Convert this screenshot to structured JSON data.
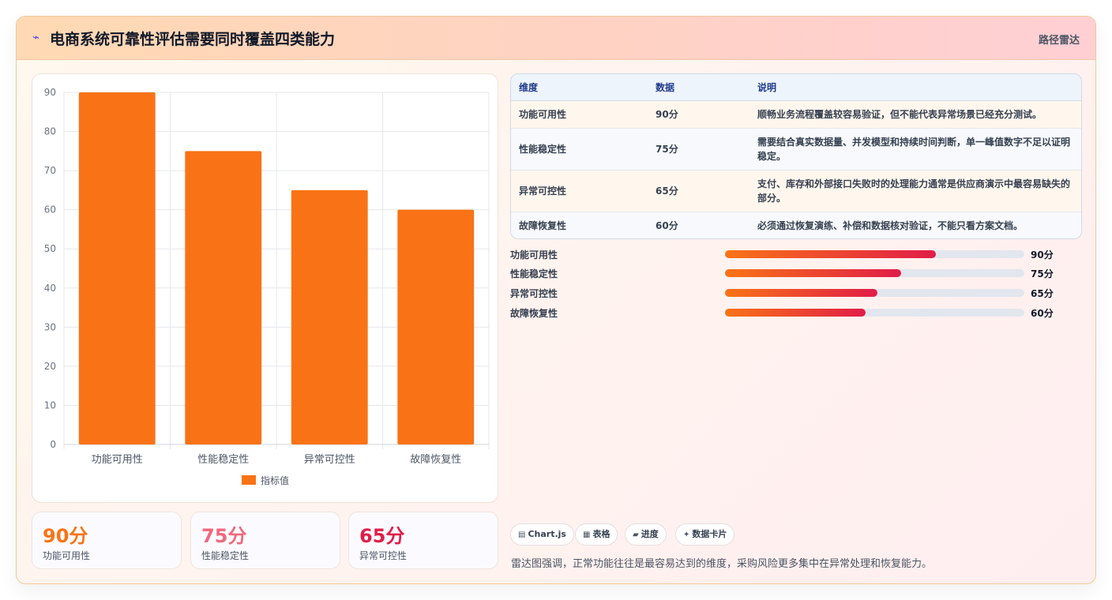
{
  "header": {
    "title": "电商系统可靠性评估需要同时覆盖四类能力",
    "tag": "路径雷达"
  },
  "chart_data": {
    "type": "bar",
    "categories": [
      "功能可用性",
      "性能稳定性",
      "异常可控性",
      "故障恢复性"
    ],
    "series": [
      {
        "name": "指标值",
        "values": [
          90,
          75,
          65,
          60
        ]
      }
    ],
    "ylim": [
      0,
      90
    ],
    "yticks": [
      0,
      10,
      20,
      30,
      40,
      50,
      60,
      70,
      80,
      90
    ],
    "bar_color": "#f97316",
    "grid": true,
    "legend": "bottom"
  },
  "stats": [
    {
      "value": "90分",
      "label": "功能可用性",
      "color": "#f97316"
    },
    {
      "value": "75分",
      "label": "性能稳定性",
      "color": "#f0687c"
    },
    {
      "value": "65分",
      "label": "异常可控性",
      "color": "#e11d48"
    }
  ],
  "table": {
    "headers": [
      "维度",
      "数据",
      "说明"
    ],
    "rows": [
      [
        "功能可用性",
        "90分",
        "顺畅业务流程覆盖较容易验证，但不能代表异常场景已经充分测试。"
      ],
      [
        "性能稳定性",
        "75分",
        "需要结合真实数据量、并发模型和持续时间判断，单一峰值数字不足以证明稳定。"
      ],
      [
        "异常可控性",
        "65分",
        "支付、库存和外部接口失败时的处理能力通常是供应商演示中最容易缺失的部分。"
      ],
      [
        "故障恢复性",
        "60分",
        "必须通过恢复演练、补偿和数据核对验证，不能只看方案文档。"
      ]
    ]
  },
  "progress": [
    {
      "name": "功能可用性",
      "label": "90分",
      "fraction": 0.705
    },
    {
      "name": "性能稳定性",
      "label": "75分",
      "fraction": 0.588
    },
    {
      "name": "异常可控性",
      "label": "65分",
      "fraction": 0.509
    },
    {
      "name": "故障恢复性",
      "label": "60分",
      "fraction": 0.47
    }
  ],
  "chips": [
    {
      "icon": "▤",
      "label": "Chart.js"
    },
    {
      "icon": "▦",
      "label": "表格"
    },
    {
      "icon": "▰",
      "label": "进度"
    },
    {
      "icon": "✦",
      "label": "数据卡片"
    }
  ],
  "note": "雷达图强调，正常功能往往是最容易达到的维度，采购风险更多集中在异常处理和恢复能力。"
}
